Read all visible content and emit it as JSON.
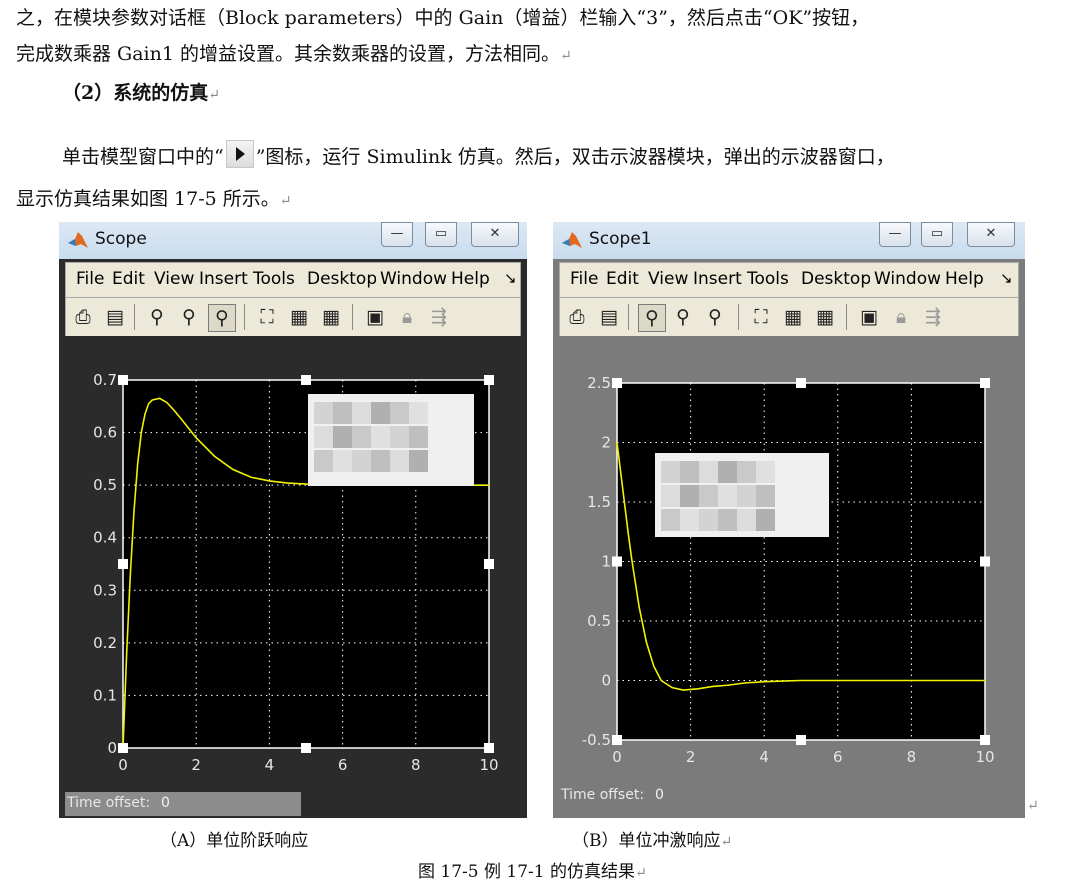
{
  "doc": {
    "line1": "之，在模块参数对话框（Block parameters）中的 Gain（增益）栏输入“3”，然后点击“OK”按钮，",
    "line2": "完成数乘器 Gain1 的增益设置。其余数乘器的设置，方法相同。",
    "heading": "（2）系统的仿真",
    "line3_a": "单击模型窗口中的“",
    "line3_b": "”图标，运行 Simulink 仿真。然后，双击示波器模块，弹出的示波器窗口，",
    "line4": "显示仿真结果如图 17-5 所示。",
    "para_mark": "↵",
    "caption_a": "（A）单位阶跃响应",
    "caption_b": "（B）单位冲激响应",
    "figure_caption": "图 17-5    例 17-1 的仿真结果"
  },
  "menu": [
    "File",
    "Edit",
    "View",
    "Insert",
    "Tools",
    "Desktop",
    "Window",
    "Help"
  ],
  "menu_arrow": "↘",
  "window_controls": {
    "minimize": "—",
    "restore": "▭",
    "close": "✕"
  },
  "icons": {
    "print": "print-icon",
    "params": "parameters-icon",
    "zoom_in": "zoom-in-icon",
    "zoom_x": "zoom-x-icon",
    "zoom_y": "zoom-y-icon",
    "autoscale": "autoscale-icon",
    "save_axes": "save-axes-icon",
    "restore_axes": "restore-axes-icon",
    "floating": "floating-scope-icon",
    "lock": "lock-icon",
    "signal": "signal-selection-icon"
  },
  "scopes": [
    {
      "title": "Scope",
      "time_offset_label": "Time offset:",
      "time_offset_value": "0",
      "colors": {
        "background": "#000000",
        "frame": "#2b2b2b",
        "trace": "#f2f200",
        "grid": "#ffffff"
      },
      "chart_data": {
        "type": "line",
        "title": "",
        "xlabel": "",
        "ylabel": "",
        "xlim": [
          0,
          10
        ],
        "ylim": [
          0,
          0.7
        ],
        "xticks": [
          "0",
          "2",
          "4",
          "6",
          "8",
          "10"
        ],
        "yticks": [
          "0",
          "0.1",
          "0.2",
          "0.3",
          "0.4",
          "0.5",
          "0.6",
          "0.7"
        ],
        "grid": true,
        "series": [
          {
            "x": [
              0,
              0.1,
              0.2,
              0.3,
              0.4,
              0.5,
              0.6,
              0.7,
              0.8,
              1.0,
              1.2,
              1.4,
              1.6,
              2.0,
              2.5,
              3.0,
              3.5,
              4.0,
              4.5,
              5.0,
              6.0,
              7.0,
              8.0,
              10.0
            ],
            "y": [
              0,
              0.18,
              0.33,
              0.45,
              0.54,
              0.6,
              0.635,
              0.655,
              0.662,
              0.665,
              0.657,
              0.642,
              0.625,
              0.59,
              0.555,
              0.53,
              0.515,
              0.508,
              0.504,
              0.502,
              0.5,
              0.5,
              0.5,
              0.5
            ]
          }
        ]
      }
    },
    {
      "title": "Scope1",
      "time_offset_label": "Time offset:",
      "time_offset_value": "0",
      "colors": {
        "background": "#000000",
        "frame": "#7b7b7b",
        "trace": "#f2f200",
        "grid": "#ffffff"
      },
      "chart_data": {
        "type": "line",
        "title": "",
        "xlabel": "",
        "ylabel": "",
        "xlim": [
          0,
          10
        ],
        "ylim": [
          -0.5,
          2.5
        ],
        "xticks": [
          "0",
          "2",
          "4",
          "6",
          "8",
          "10"
        ],
        "yticks": [
          "-0.5",
          "0",
          "0.5",
          "1",
          "1.5",
          "2",
          "2.5"
        ],
        "grid": true,
        "series": [
          {
            "x": [
              0,
              0.1,
              0.2,
              0.3,
              0.4,
              0.6,
              0.8,
              1.0,
              1.2,
              1.5,
              1.8,
              2.2,
              2.6,
              3.0,
              3.5,
              4.0,
              4.5,
              5.0,
              6.0,
              8.0,
              10.0
            ],
            "y": [
              2.0,
              1.75,
              1.5,
              1.25,
              1.02,
              0.62,
              0.32,
              0.12,
              0.0,
              -0.06,
              -0.08,
              -0.07,
              -0.05,
              -0.04,
              -0.02,
              -0.01,
              -0.005,
              0,
              0,
              0,
              0
            ]
          }
        ]
      }
    }
  ]
}
